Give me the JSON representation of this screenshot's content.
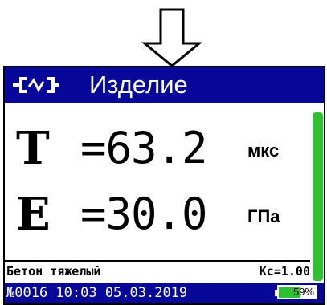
{
  "header": {
    "title": "Изделие",
    "icon": "probe-icon"
  },
  "measurements": {
    "t": {
      "symbol": "T",
      "value": "=63.2",
      "unit": "мкс"
    },
    "e": {
      "symbol": "E",
      "value": "=30.0",
      "unit": "ГПа"
    }
  },
  "material": {
    "name": "Бетон тяжелый",
    "coefficient": "Кс=1.00"
  },
  "level_indicator": {
    "fraction": 1.0,
    "color": "#2fc12f"
  },
  "status": {
    "text": "№0016 10:03 05.03.2019",
    "battery_label": "59%",
    "battery_level": 0.59
  },
  "colors": {
    "header_bg": "#07079a",
    "status_bg": "#07079a",
    "battery_fill": "#2fc12f",
    "level_bar": "#2fc12f"
  },
  "decor": {
    "arrow": "down-arrow-icon"
  }
}
